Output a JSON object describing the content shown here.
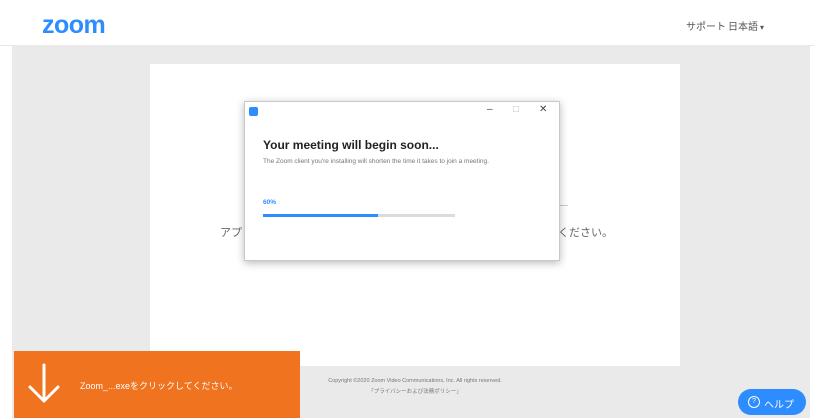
{
  "header": {
    "logo": "zoom",
    "nav": {
      "support": "サポート",
      "language": "日本語",
      "language_chevron": "▾"
    }
  },
  "background_page": {
    "text_left": "アプ",
    "text_right": "ください。"
  },
  "dialog": {
    "title": "Your meeting will begin soon...",
    "description": "The Zoom client you're installing will shorten the time it takes to join a meeting.",
    "progress_label": "60%",
    "progress": 0.6,
    "controls": {
      "minimize": "–",
      "maximize": "□",
      "close": "✕"
    }
  },
  "footer": {
    "copyright": "Copyright ©2020 Zoom Video Communications, Inc. All rights reserved.",
    "privacy_link": "「プライバシーおよび法務ポリシー」"
  },
  "download_banner": {
    "text": "Zoom_...exeをクリックしてください。",
    "icon": "down-arrow-icon"
  },
  "help_button": {
    "label": "ヘルプ",
    "icon": "question-circle-icon",
    "icon_glyph": "?"
  },
  "colors": {
    "brand": "#2d8cff",
    "download_banner": "#f0731f",
    "page_background": "#eaeaea"
  }
}
